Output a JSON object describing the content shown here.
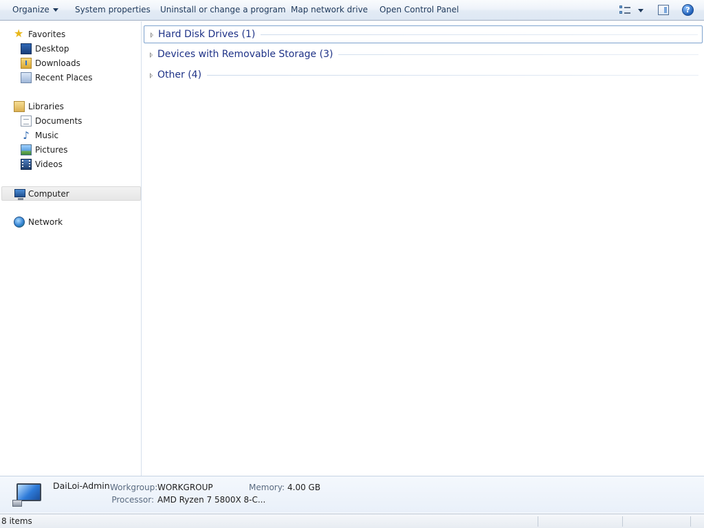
{
  "commandbar": {
    "organize": "Organize",
    "system_properties": "System properties",
    "uninstall": "Uninstall or change a program",
    "map_network_drive": "Map network drive",
    "open_control_panel": "Open Control Panel",
    "help": "?"
  },
  "navigation": {
    "favorites": {
      "label": "Favorites",
      "items": [
        "Desktop",
        "Downloads",
        "Recent Places"
      ]
    },
    "libraries": {
      "label": "Libraries",
      "items": [
        "Documents",
        "Music",
        "Pictures",
        "Videos"
      ]
    },
    "computer": "Computer",
    "network": "Network"
  },
  "groups": [
    {
      "title": "Hard Disk Drives (1)",
      "expanded": false,
      "focused": true
    },
    {
      "title": "Devices with Removable Storage (3)",
      "expanded": false,
      "focused": false
    },
    {
      "title": "Other (4)",
      "expanded": false,
      "focused": false
    }
  ],
  "details": {
    "name": "DaiLoi-Admin",
    "workgroup_label": "Workgroup:",
    "workgroup_value": "WORKGROUP",
    "memory_label": "Memory:",
    "memory_value": "4.00 GB",
    "processor_label": "Processor:",
    "processor_value": "AMD Ryzen 7 5800X 8-C..."
  },
  "status": {
    "items_count": "8 items"
  },
  "colors": {
    "group_header_text": "#1e3287",
    "command_text": "#1e395b",
    "selected_nav_bg": "#e9e9e9"
  }
}
